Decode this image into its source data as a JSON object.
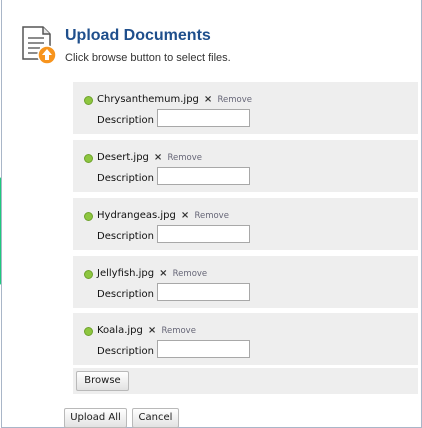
{
  "header": {
    "title": "Upload Documents",
    "subtitle": "Click browse button to select files.",
    "icon": "document-upload-icon"
  },
  "files": [
    {
      "name": "Chrysanthemum.jpg",
      "remove_symbol": "×",
      "remove_label": "Remove",
      "description_label": "Description :",
      "description_value": ""
    },
    {
      "name": "Desert.jpg",
      "remove_symbol": "×",
      "remove_label": "Remove",
      "description_label": "Description :",
      "description_value": ""
    },
    {
      "name": "Hydrangeas.jpg",
      "remove_symbol": "×",
      "remove_label": "Remove",
      "description_label": "Description :",
      "description_value": ""
    },
    {
      "name": "Jellyfish.jpg",
      "remove_symbol": "×",
      "remove_label": "Remove",
      "description_label": "Description :",
      "description_value": ""
    },
    {
      "name": "Koala.jpg",
      "remove_symbol": "×",
      "remove_label": "Remove",
      "description_label": "Description :",
      "description_value": ""
    }
  ],
  "buttons": {
    "browse": "Browse",
    "upload_all": "Upload All",
    "cancel": "Cancel"
  },
  "colors": {
    "accent_green": "#1ec97c",
    "status_dot": "#8dc63f",
    "title_blue": "#1f4f8c"
  }
}
